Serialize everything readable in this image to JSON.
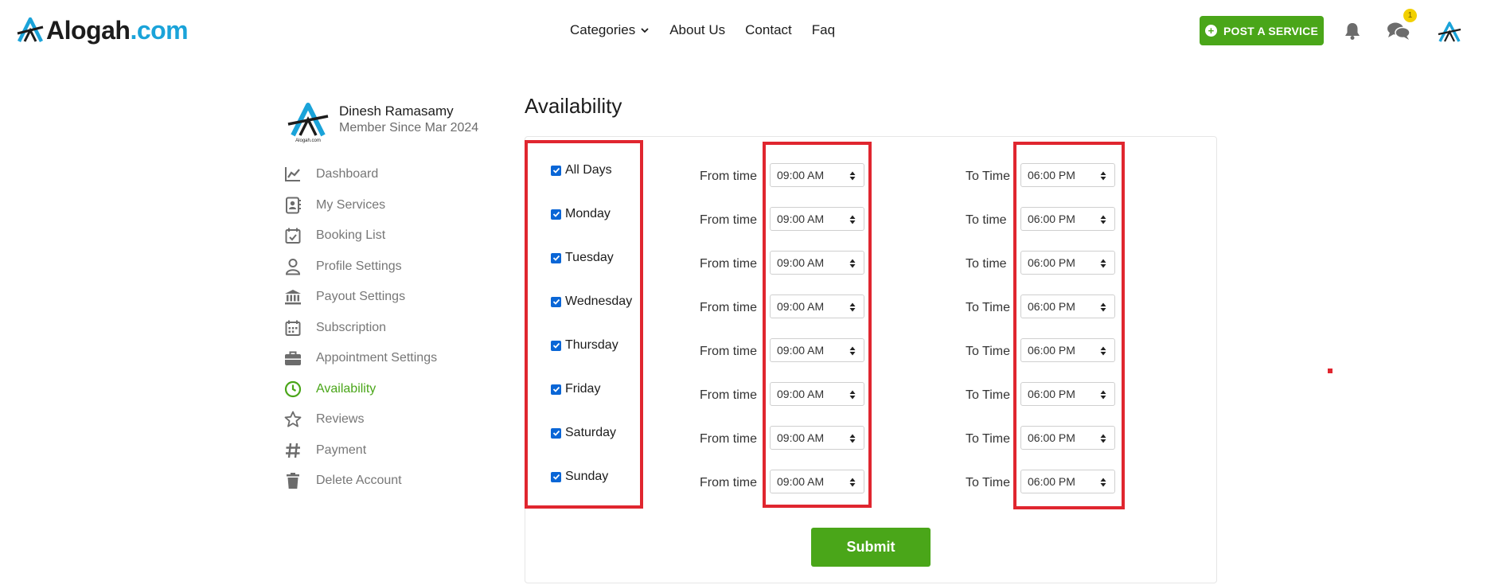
{
  "header": {
    "logo_brand": "Alogah",
    "logo_tld": ".com",
    "nav": [
      {
        "label": "Categories"
      },
      {
        "label": "About Us"
      },
      {
        "label": "Contact"
      },
      {
        "label": "Faq"
      }
    ],
    "post_button": "POST A SERVICE",
    "chat_badge": "1"
  },
  "profile": {
    "name": "Dinesh Ramasamy",
    "member_since": "Member Since Mar 2024",
    "logo_text": "Alogah.com"
  },
  "sidebar": {
    "items": [
      {
        "label": "Dashboard",
        "icon": "chart-line-icon"
      },
      {
        "label": "My Services",
        "icon": "address-book-icon"
      },
      {
        "label": "Booking List",
        "icon": "calendar-check-icon"
      },
      {
        "label": "Profile Settings",
        "icon": "user-icon"
      },
      {
        "label": "Payout Settings",
        "icon": "bank-icon"
      },
      {
        "label": "Subscription",
        "icon": "calendar-icon"
      },
      {
        "label": "Appointment Settings",
        "icon": "briefcase-icon"
      },
      {
        "label": "Availability",
        "icon": "clock-icon",
        "active": true
      },
      {
        "label": "Reviews",
        "icon": "star-icon"
      },
      {
        "label": "Payment",
        "icon": "hashtag-icon"
      },
      {
        "label": "Delete Account",
        "icon": "trash-icon"
      }
    ]
  },
  "main": {
    "title": "Availability",
    "rows": [
      {
        "day": "All Days",
        "from_label": "From time",
        "from": "09:00 AM",
        "to_label": "To Time",
        "to": "06:00 PM"
      },
      {
        "day": "Monday",
        "from_label": "From time",
        "from": "09:00 AM",
        "to_label": "To time",
        "to": "06:00 PM"
      },
      {
        "day": "Tuesday",
        "from_label": "From time",
        "from": "09:00 AM",
        "to_label": "To time",
        "to": "06:00 PM"
      },
      {
        "day": "Wednesday",
        "from_label": "From time",
        "from": "09:00 AM",
        "to_label": "To Time",
        "to": "06:00 PM"
      },
      {
        "day": "Thursday",
        "from_label": "From time",
        "from": "09:00 AM",
        "to_label": "To Time",
        "to": "06:00 PM"
      },
      {
        "day": "Friday",
        "from_label": "From time",
        "from": "09:00 AM",
        "to_label": "To Time",
        "to": "06:00 PM"
      },
      {
        "day": "Saturday",
        "from_label": "From time",
        "from": "09:00 AM",
        "to_label": "To Time",
        "to": "06:00 PM"
      },
      {
        "day": "Sunday",
        "from_label": "From time",
        "from": "09:00 AM",
        "to_label": "To Time",
        "to": "06:00 PM"
      }
    ],
    "submit_label": "Submit"
  },
  "colors": {
    "accent_green": "#4aa619",
    "brand_blue": "#1aa3d9",
    "highlight_red": "#e0262f",
    "checkbox_blue": "#0a66d6"
  }
}
